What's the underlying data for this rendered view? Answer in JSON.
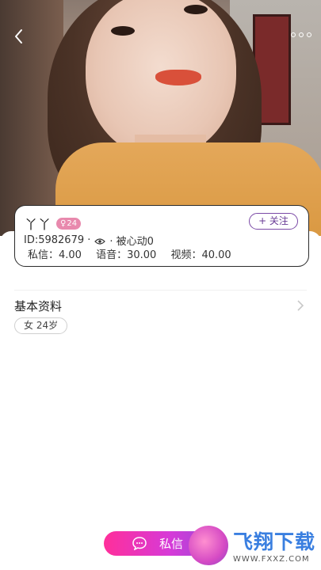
{
  "header": {
    "back_icon": "chevron-left-icon",
    "more_icon": "more-horizontal-icon"
  },
  "profile": {
    "name": "丫丫",
    "gender_symbol": "♀",
    "age_badge": "24",
    "follow_label": "+ 关注",
    "id_text": "ID:5982679 ·",
    "heart_text": "· 被心动0",
    "prices": {
      "message": "私信：4.00",
      "voice": "语音：30.00",
      "video": "视频：40.00"
    }
  },
  "basic_info": {
    "title": "基本资料",
    "tag": "女 24岁"
  },
  "actions": {
    "chat_label": "私信"
  },
  "watermark": {
    "big": "飞翔下载",
    "small": "WWW.FXXZ.COM"
  },
  "colors": {
    "accent_purple": "#7b4aa6",
    "badge_pink": "#e889ad",
    "chat_gradient_start": "#ff2f9a",
    "chat_gradient_end": "#9a4ad8"
  }
}
